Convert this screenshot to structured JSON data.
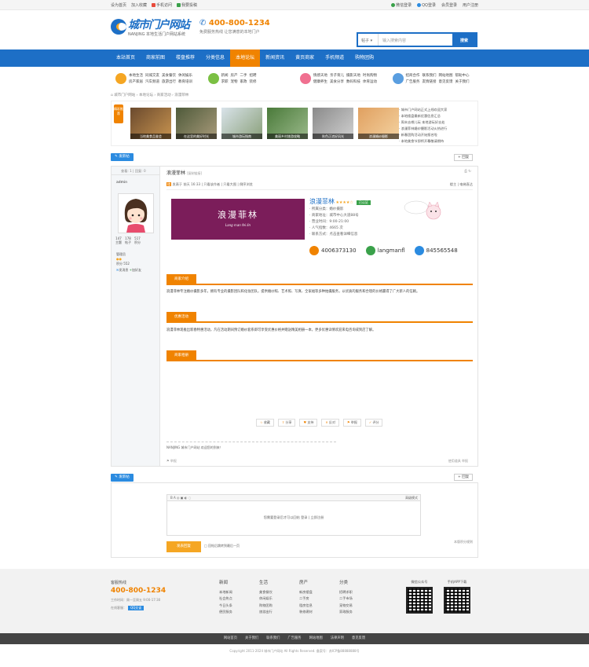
{
  "topbar": {
    "left": [
      "设为首页",
      "加入收藏",
      "手机访问",
      "我要投稿"
    ],
    "right": [
      "微信登录",
      "QQ登录",
      "会员登录",
      "用户注册"
    ]
  },
  "logo": {
    "name": "城市门户网站",
    "slogan": "NANJING 本地生活门户网站系统"
  },
  "hotline": {
    "phone": "400-800-1234",
    "slogan": "免费服务热线 让您满意的本地门户"
  },
  "search": {
    "scope": "帖子",
    "placeholder": "输入搜索内容",
    "button": "搜索"
  },
  "nav": [
    "本站首页",
    "商家前图",
    "楼盘推荐",
    "分类信息",
    "本地论坛",
    "新闻资讯",
    "黄页商家",
    "手机频道",
    "购物团购"
  ],
  "nav_active": 4,
  "quick": [
    {
      "color": "#f5a623",
      "links": [
        "本地生活",
        "同城交友",
        "美食餐饮",
        "休闲娱乐",
        "房产家居",
        "汽车频道",
        "旅游出行",
        "教育培训"
      ]
    },
    {
      "color": "#7bc043",
      "links": [
        "新闻",
        "房产",
        "二手",
        "招聘",
        "求职",
        "宠物",
        "家政",
        "装修"
      ]
    },
    {
      "color": "#f07090",
      "links": [
        "情感天地",
        "亲子育儿",
        "摄影天地",
        "时尚购物",
        "健康养生",
        "美食分享",
        "数码科技",
        "体育运动"
      ]
    },
    {
      "color": "#5a9ee0",
      "links": [
        "招商合作",
        "联系我们",
        "网站地图",
        "帮助中心",
        "广告服务",
        "友情链接",
        "意见反馈",
        "关于我们"
      ]
    }
  ],
  "breadcrumb": "城市门户网站 › 本地论坛 › 商家活动 › 浪漫菲林",
  "slide": {
    "tag": "精彩推荐",
    "captions": [
      "当地美食品鉴会",
      "在这里的美好时光",
      "城市游玩指南",
      "美丽乡村旅游攻略",
      "秋色正浓好风光",
      "浪漫婚纱摄影"
    ],
    "news": [
      "· 城市门户网站正式上线欢迎大家",
      "· 本地楼盘最新优惠信息汇总",
      "· 周末去哪儿玩 本地游玩好去处",
      "· 浪漫菲林婚纱摄影活动火热进行",
      "· 新春团购活动开始报名啦",
      "· 本地美食节即将开幕敬请期待"
    ]
  },
  "buttons": {
    "post_new": "发新帖",
    "reply": "回复"
  },
  "post": {
    "side_header": "查看: 1 | 回复: 0",
    "author": "admin",
    "stats": [
      {
        "n": "147",
        "l": "主题"
      },
      {
        "n": "178",
        "l": "帖子"
      },
      {
        "n": "517",
        "l": "积分"
      }
    ],
    "meta": [
      "管理员",
      "积分 552",
      "发消息",
      "加好友"
    ],
    "title": "浪漫菲林",
    "title_tag": "[复制链接]",
    "meta_line": "发表于 前天 16:33 | 只看该作者 | 只看大图 | 倒序浏览",
    "meta_right": "楼主 | 电梯直达",
    "card_main": "浪漫菲林",
    "card_sub": "Lang man fei lin",
    "shop_name": "浪漫菲林",
    "stars": "★★★★☆",
    "tag": "已认证",
    "info": [
      "· 所属分类：婚纱摄影",
      "· 商家地址：城市中心大道88号",
      "· 营业时间：9:00-21:00",
      "· 人气指数：4665 次",
      "· 联系方式：点击查看详细信息"
    ],
    "phone": "4006373130",
    "wechat": "langmanfl",
    "qq": "845565548",
    "sections": [
      "商家介绍",
      "优惠活动",
      "商家相册"
    ],
    "intro": "浪漫菲林专注婚纱摄影多年，拥有专业的摄影团队和化妆团队，提供婚纱照、艺术照、写真、全家福等多种拍摄服务，以优质的服务和合理的价格赢得了广大新人的信赖。",
    "promo": "浪漫菲林现推出新春特惠活动，凡在活动期间预订婚纱套系即可享受优惠价格并赠送精美相册一本，更多优惠详情欢迎来电咨询或到店了解。",
    "actions": [
      "收藏",
      "分享",
      "支持",
      "反对",
      "举报",
      "评分"
    ],
    "signature": "NANJING 城市门户网站 欢迎您的到来！",
    "bottom_left": "举报",
    "bottom_right": "使用道具 举报"
  },
  "reply": {
    "toolbar": "B  A  ◎  ▣  ◐  ◌",
    "toolbar_right": "高级模式",
    "placeholder": "您需要登录后才可以回帖  登录 | 立即注册",
    "submit": "发表回复",
    "options": "□ 回帖后跳转到最后一页",
    "right": "本版积分规则"
  },
  "footer": {
    "cs_label": "客服热线",
    "cs_phone": "400-800-1234",
    "cs_time": "工作时间：周一至周五 9:00-17:30",
    "cs_qq_label": "在线客服：",
    "cs_qq": "QQ交谈",
    "columns": [
      {
        "h": "新闻",
        "items": [
          "本地新闻",
          "社会热点",
          "今日头条",
          "便民服务"
        ]
      },
      {
        "h": "生活",
        "items": [
          "美食餐饮",
          "休闲娱乐",
          "购物团购",
          "旅游出行"
        ]
      },
      {
        "h": "房产",
        "items": [
          "新房楼盘",
          "二手房",
          "租房信息",
          "装修建材"
        ]
      },
      {
        "h": "分类",
        "items": [
          "招聘求职",
          "二手市场",
          "宠物交易",
          "家政服务"
        ]
      }
    ],
    "qr1": "微信公众号",
    "qr2": "手机APP下载"
  },
  "bottom_nav": [
    "网站首页",
    "关于我们",
    "联系我们",
    "广告服务",
    "网站地图",
    "法律声明",
    "意见反馈"
  ],
  "copyright": "Copyright 2011-2024 城市门户网站 All Rights Reserved. 备案号：苏ICP备88888888号"
}
